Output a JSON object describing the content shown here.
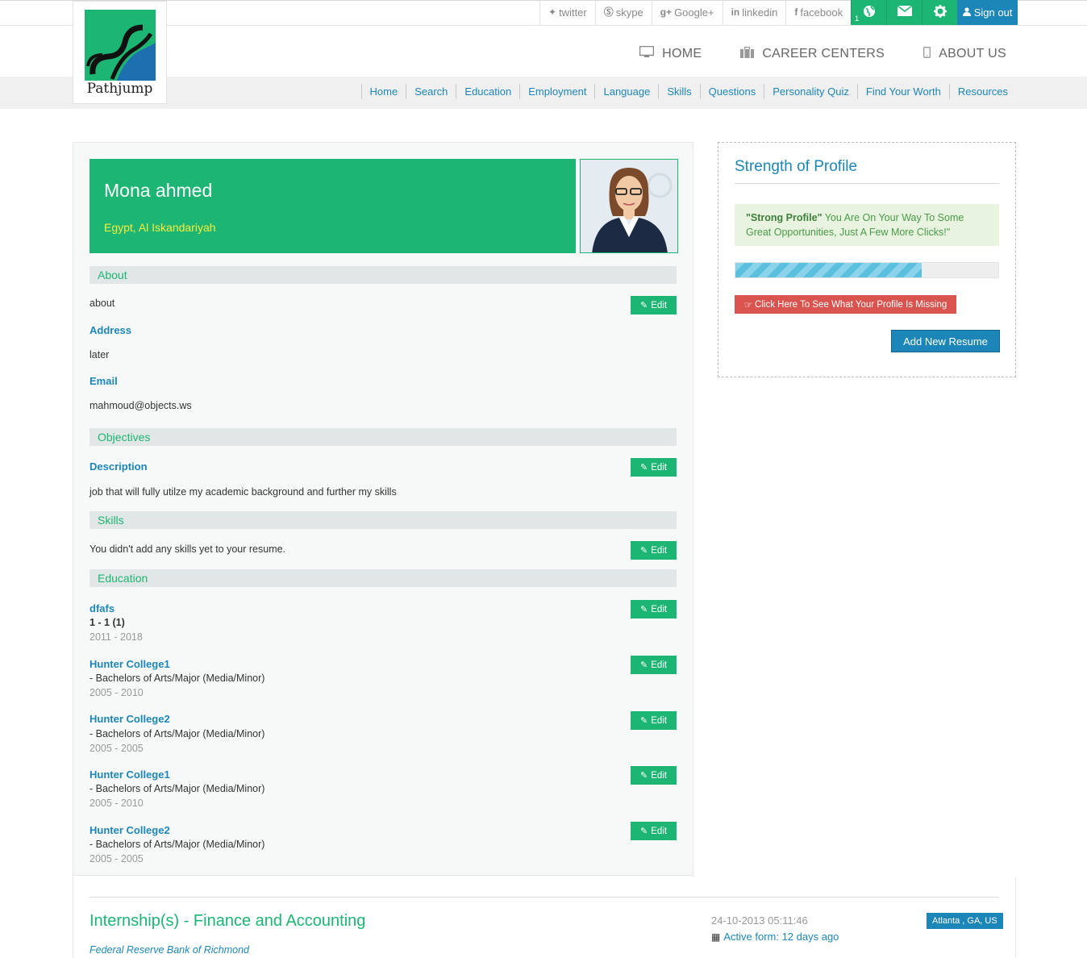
{
  "topbar": {
    "social": [
      {
        "icon": "twitter-icon",
        "glyph": "🐦",
        "label": "twitter"
      },
      {
        "icon": "skype-icon",
        "glyph": "S",
        "label": "skype"
      },
      {
        "icon": "google-plus-icon",
        "glyph": "g+",
        "label": "Google+"
      },
      {
        "icon": "linkedin-icon",
        "glyph": "in",
        "label": "linkedin"
      },
      {
        "icon": "facebook-icon",
        "glyph": "f",
        "label": "facebook"
      }
    ],
    "globe_count": "1",
    "signout_label": "Sign out"
  },
  "logo": {
    "name": "Pathjump"
  },
  "mainnav": {
    "home": "HOME",
    "career": "CAREER CENTERS",
    "about": "ABOUT US"
  },
  "subnav": [
    "Home",
    "Search",
    "Education",
    "Employment",
    "Language",
    "Skills",
    "Questions",
    "Personality Quiz",
    "Find Your Worth",
    "Resources"
  ],
  "profile": {
    "name": "Mona ahmed",
    "location": "Egypt, Al Iskandariyah",
    "edit_label": "Edit",
    "about": {
      "heading": "About",
      "text": "about",
      "address_label": "Address",
      "address": "later",
      "email_label": "Email",
      "email": "mahmoud@objects.ws"
    },
    "objectives": {
      "heading": "Objectives",
      "description_label": "Description",
      "description": "job that will fully utilze my academic background and further my skills"
    },
    "skills": {
      "heading": "Skills",
      "text": "You didn't add any skills yet to your resume."
    },
    "education": {
      "heading": "Education",
      "items": [
        {
          "title": "dfafs",
          "sub": "1 - 1 (1)",
          "years": "2011 - 2018"
        },
        {
          "title": "Hunter College1",
          "sub": "- Bachelors of Arts/Major (Media/Minor)",
          "years": "2005 - 2010"
        },
        {
          "title": "Hunter College2",
          "sub": "- Bachelors of Arts/Major (Media/Minor)",
          "years": "2005 - 2005"
        },
        {
          "title": "Hunter College1",
          "sub": "- Bachelors of Arts/Major (Media/Minor)",
          "years": "2005 - 2010"
        },
        {
          "title": "Hunter College2",
          "sub": "- Bachelors of Arts/Major (Media/Minor)",
          "years": "2005 - 2005"
        }
      ]
    }
  },
  "strength": {
    "title": "Strength of Profile",
    "note_strong": "\"Strong Profile\"",
    "note_rest": " You Are On Your Way To Some Great Opportunities, Just A Few More Clicks!\"",
    "progress": 0.71,
    "missing_label": "Click Here To See What Your Profile Is Missing",
    "add_resume_label": "Add New Resume"
  },
  "job": {
    "title": "Internship(s) - Finance and Accounting",
    "company": "Federal Reserve Bank of Richmond",
    "date": "24-10-2013 05:11:46",
    "active": "Active form: 12 days ago",
    "location": "Atlanta , GA, US"
  },
  "colors": {
    "green": "#1db574",
    "blue": "#1d86b8",
    "red": "#d9534f",
    "yellow": "#f4ef3c"
  }
}
